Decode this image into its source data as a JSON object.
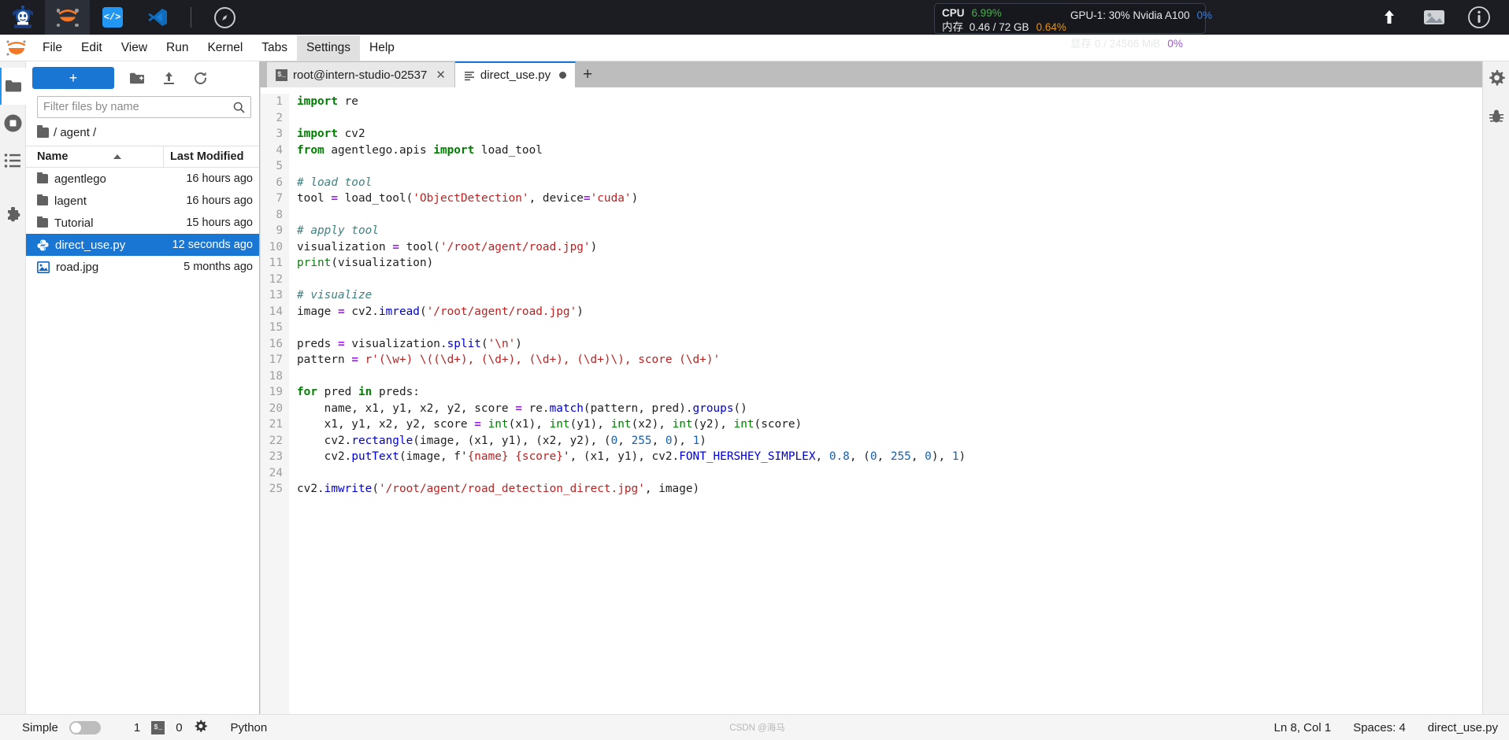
{
  "topbar": {
    "icons": [
      {
        "name": "intern-studio-logo",
        "label": "InternStudio"
      },
      {
        "name": "jupyter-logo",
        "label": "Jupyter"
      },
      {
        "name": "code-server-icon",
        "label": "Code Server"
      },
      {
        "name": "vscode-icon",
        "label": "VS Code"
      },
      {
        "name": "compass-icon",
        "label": "Explore"
      }
    ],
    "resources": {
      "cpu_label": "CPU",
      "cpu_value": "6.99%",
      "gpu_label": "GPU-1: 30% Nvidia A100",
      "gpu_value": "0%",
      "mem_label": "内存",
      "mem_value": "0.46 / 72 GB",
      "mem_pct": "0.64%",
      "vram_label": "显存",
      "vram_value": "0 / 24566 MiB",
      "vram_pct": "0%"
    },
    "right_icons": [
      {
        "name": "upload-icon"
      },
      {
        "name": "image-icon"
      },
      {
        "name": "info-icon"
      }
    ]
  },
  "menubar": {
    "items": [
      {
        "label": "File",
        "highlighted": false
      },
      {
        "label": "Edit",
        "highlighted": false
      },
      {
        "label": "View",
        "highlighted": false
      },
      {
        "label": "Run",
        "highlighted": false
      },
      {
        "label": "Kernel",
        "highlighted": false
      },
      {
        "label": "Tabs",
        "highlighted": false
      },
      {
        "label": "Settings",
        "highlighted": true
      },
      {
        "label": "Help",
        "highlighted": false
      }
    ]
  },
  "left_rail": [
    {
      "name": "sidebar-file-browser",
      "icon": "folder-icon",
      "active": true
    },
    {
      "name": "sidebar-running-terminals",
      "icon": "stop-circle-icon",
      "active": false
    },
    {
      "name": "sidebar-table-of-contents",
      "icon": "list-icon",
      "active": false
    },
    {
      "name": "sidebar-extension-manager",
      "icon": "puzzle-icon",
      "active": false
    }
  ],
  "filebrowser": {
    "new_button": "+",
    "new_folder_tooltip": "New Folder",
    "upload_tooltip": "Upload",
    "refresh_tooltip": "Refresh",
    "filter_placeholder": "Filter files by name",
    "filter_value": "",
    "breadcrumb": "/ agent /",
    "columns": [
      "Name",
      "Last Modified"
    ],
    "sort_column": "Name",
    "sort_direction": "asc",
    "rows": [
      {
        "name": "agentlego",
        "modified": "16 hours ago",
        "type": "folder",
        "selected": false
      },
      {
        "name": "lagent",
        "modified": "16 hours ago",
        "type": "folder",
        "selected": false
      },
      {
        "name": "Tutorial",
        "modified": "15 hours ago",
        "type": "folder",
        "selected": false
      },
      {
        "name": "direct_use.py",
        "modified": "12 seconds ago",
        "type": "python",
        "selected": true
      },
      {
        "name": "road.jpg",
        "modified": "5 months ago",
        "type": "image",
        "selected": false
      }
    ]
  },
  "tabs": [
    {
      "label": "root@intern-studio-02537",
      "icon": "terminal-icon",
      "active": false,
      "closable": true,
      "dirty": false
    },
    {
      "label": "direct_use.py",
      "icon": "file-text-icon",
      "active": true,
      "closable": false,
      "dirty": true
    }
  ],
  "tab_add_label": "+",
  "editor": {
    "filename": "direct_use.py",
    "lines": [
      {
        "n": 1,
        "tokens": [
          {
            "t": "import",
            "c": "k"
          },
          {
            "t": " re",
            "c": ""
          }
        ]
      },
      {
        "n": 2,
        "tokens": []
      },
      {
        "n": 3,
        "tokens": [
          {
            "t": "import",
            "c": "k"
          },
          {
            "t": " cv2",
            "c": ""
          }
        ]
      },
      {
        "n": 4,
        "tokens": [
          {
            "t": "from",
            "c": "k"
          },
          {
            "t": " agentlego.apis ",
            "c": ""
          },
          {
            "t": "import",
            "c": "k"
          },
          {
            "t": " load_tool",
            "c": ""
          }
        ]
      },
      {
        "n": 5,
        "tokens": []
      },
      {
        "n": 6,
        "tokens": [
          {
            "t": "# load tool",
            "c": "c"
          }
        ]
      },
      {
        "n": 7,
        "tokens": [
          {
            "t": "tool ",
            "c": ""
          },
          {
            "t": "=",
            "c": "o"
          },
          {
            "t": " load_tool(",
            "c": ""
          },
          {
            "t": "'ObjectDetection'",
            "c": "s"
          },
          {
            "t": ", device",
            "c": ""
          },
          {
            "t": "=",
            "c": "o"
          },
          {
            "t": "'cuda'",
            "c": "s"
          },
          {
            "t": ")",
            "c": ""
          }
        ]
      },
      {
        "n": 8,
        "tokens": []
      },
      {
        "n": 9,
        "tokens": [
          {
            "t": "# apply tool",
            "c": "c"
          }
        ]
      },
      {
        "n": 10,
        "tokens": [
          {
            "t": "visualization ",
            "c": ""
          },
          {
            "t": "=",
            "c": "o"
          },
          {
            "t": " tool(",
            "c": ""
          },
          {
            "t": "'/root/agent/road.jpg'",
            "c": "s"
          },
          {
            "t": ")",
            "c": ""
          }
        ]
      },
      {
        "n": 11,
        "tokens": [
          {
            "t": "print",
            "c": "nb"
          },
          {
            "t": "(visualization)",
            "c": ""
          }
        ]
      },
      {
        "n": 12,
        "tokens": []
      },
      {
        "n": 13,
        "tokens": [
          {
            "t": "# visualize",
            "c": "c"
          }
        ]
      },
      {
        "n": 14,
        "tokens": [
          {
            "t": "image ",
            "c": ""
          },
          {
            "t": "=",
            "c": "o"
          },
          {
            "t": " cv2.",
            "c": ""
          },
          {
            "t": "imread",
            "c": "fn"
          },
          {
            "t": "(",
            "c": ""
          },
          {
            "t": "'/root/agent/road.jpg'",
            "c": "s"
          },
          {
            "t": ")",
            "c": ""
          }
        ]
      },
      {
        "n": 15,
        "tokens": []
      },
      {
        "n": 16,
        "tokens": [
          {
            "t": "preds ",
            "c": ""
          },
          {
            "t": "=",
            "c": "o"
          },
          {
            "t": " visualization.",
            "c": ""
          },
          {
            "t": "split",
            "c": "fn"
          },
          {
            "t": "(",
            "c": ""
          },
          {
            "t": "'\\n'",
            "c": "s"
          },
          {
            "t": ")",
            "c": ""
          }
        ]
      },
      {
        "n": 17,
        "tokens": [
          {
            "t": "pattern ",
            "c": ""
          },
          {
            "t": "=",
            "c": "o"
          },
          {
            "t": " r'(\\w+) \\((\\d+), (\\d+), (\\d+), (\\d+)\\), score (\\d+)'",
            "c": "s"
          }
        ]
      },
      {
        "n": 18,
        "tokens": []
      },
      {
        "n": 19,
        "tokens": [
          {
            "t": "for",
            "c": "k"
          },
          {
            "t": " pred ",
            "c": ""
          },
          {
            "t": "in",
            "c": "k"
          },
          {
            "t": " preds:",
            "c": ""
          }
        ]
      },
      {
        "n": 20,
        "tokens": [
          {
            "t": "    name, x1, y1, x2, y2, score ",
            "c": ""
          },
          {
            "t": "=",
            "c": "o"
          },
          {
            "t": " re.",
            "c": ""
          },
          {
            "t": "match",
            "c": "fn"
          },
          {
            "t": "(pattern, pred).",
            "c": ""
          },
          {
            "t": "groups",
            "c": "fn"
          },
          {
            "t": "()",
            "c": ""
          }
        ]
      },
      {
        "n": 21,
        "tokens": [
          {
            "t": "    x1, y1, x2, y2, score ",
            "c": ""
          },
          {
            "t": "=",
            "c": "o"
          },
          {
            "t": " ",
            "c": ""
          },
          {
            "t": "int",
            "c": "bi"
          },
          {
            "t": "(x1), ",
            "c": ""
          },
          {
            "t": "int",
            "c": "bi"
          },
          {
            "t": "(y1), ",
            "c": ""
          },
          {
            "t": "int",
            "c": "bi"
          },
          {
            "t": "(x2), ",
            "c": ""
          },
          {
            "t": "int",
            "c": "bi"
          },
          {
            "t": "(y2), ",
            "c": ""
          },
          {
            "t": "int",
            "c": "bi"
          },
          {
            "t": "(score)",
            "c": ""
          }
        ]
      },
      {
        "n": 22,
        "tokens": [
          {
            "t": "    cv2.",
            "c": ""
          },
          {
            "t": "rectangle",
            "c": "fn"
          },
          {
            "t": "(image, (x1, y1), (x2, y2), (",
            "c": ""
          },
          {
            "t": "0",
            "c": "cst"
          },
          {
            "t": ", ",
            "c": ""
          },
          {
            "t": "255",
            "c": "cst"
          },
          {
            "t": ", ",
            "c": ""
          },
          {
            "t": "0",
            "c": "cst"
          },
          {
            "t": "), ",
            "c": ""
          },
          {
            "t": "1",
            "c": "cst"
          },
          {
            "t": ")",
            "c": ""
          }
        ]
      },
      {
        "n": 23,
        "tokens": [
          {
            "t": "    cv2.",
            "c": ""
          },
          {
            "t": "putText",
            "c": "fn"
          },
          {
            "t": "(image, f'",
            "c": ""
          },
          {
            "t": "{name} {score}",
            "c": "s"
          },
          {
            "t": "', (x1, y1), cv2.",
            "c": ""
          },
          {
            "t": "FONT_HERSHEY_SIMPLEX",
            "c": "fn"
          },
          {
            "t": ", ",
            "c": ""
          },
          {
            "t": "0.8",
            "c": "cst"
          },
          {
            "t": ", (",
            "c": ""
          },
          {
            "t": "0",
            "c": "cst"
          },
          {
            "t": ", ",
            "c": ""
          },
          {
            "t": "255",
            "c": "cst"
          },
          {
            "t": ", ",
            "c": ""
          },
          {
            "t": "0",
            "c": "cst"
          },
          {
            "t": "), ",
            "c": ""
          },
          {
            "t": "1",
            "c": "cst"
          },
          {
            "t": ")",
            "c": ""
          }
        ]
      },
      {
        "n": 24,
        "tokens": []
      },
      {
        "n": 25,
        "tokens": [
          {
            "t": "cv2.",
            "c": ""
          },
          {
            "t": "imwrite",
            "c": "fn"
          },
          {
            "t": "(",
            "c": ""
          },
          {
            "t": "'/root/agent/road_detection_direct.jpg'",
            "c": "s"
          },
          {
            "t": ", image)",
            "c": ""
          }
        ]
      }
    ]
  },
  "right_rail": [
    {
      "name": "property-inspector-icon",
      "icon": "gear-icon"
    },
    {
      "name": "debugger-icon",
      "icon": "bug-icon"
    }
  ],
  "statusbar": {
    "mode_label": "Simple",
    "mode_on": false,
    "kernel_count": "1",
    "terminal_count": "0",
    "settings_icon": "gear-icon",
    "language": "Python",
    "cursor_position": "Ln 8, Col 1",
    "spaces": "Spaces: 4",
    "filename": "direct_use.py",
    "watermark": "CSDN @海马"
  }
}
